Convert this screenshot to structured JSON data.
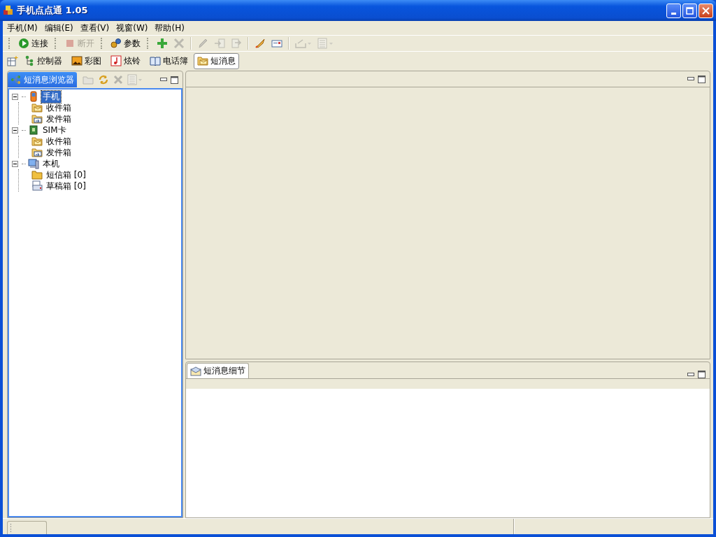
{
  "window": {
    "title": "手机点点通 1.05"
  },
  "menu": [
    {
      "label": "手机(M)"
    },
    {
      "label": "编辑(E)"
    },
    {
      "label": "查看(V)"
    },
    {
      "label": "视窗(W)"
    },
    {
      "label": "帮助(H)"
    }
  ],
  "toolbar": {
    "text_buttons": [
      {
        "label": "连接",
        "disabled": false
      },
      {
        "label": "断开",
        "disabled": true
      },
      {
        "label": "参数",
        "disabled": false
      }
    ],
    "icon_buttons": [
      {
        "disabled": false
      },
      {
        "disabled": true
      },
      {
        "disabled": true
      },
      {
        "disabled": true
      },
      {
        "disabled": true
      },
      {
        "disabled": false
      },
      {
        "disabled": false
      },
      {
        "disabled": true
      },
      {
        "disabled": true
      }
    ]
  },
  "perspectives": [
    {
      "label": "控制器",
      "selected": false
    },
    {
      "label": "彩图",
      "selected": false
    },
    {
      "label": "炫铃",
      "selected": false
    },
    {
      "label": "电话簿",
      "selected": false
    },
    {
      "label": "短消息",
      "selected": true
    }
  ],
  "browser_panel": {
    "tab": {
      "label": "短消息浏览器",
      "selected": true
    },
    "tree": [
      {
        "label": "手机",
        "selected": true,
        "expanded": true,
        "children": [
          {
            "label": "收件箱",
            "selected": false
          },
          {
            "label": "发件箱",
            "selected": false
          }
        ]
      },
      {
        "label": "SIM卡",
        "selected": false,
        "expanded": true,
        "children": [
          {
            "label": "收件箱",
            "selected": false
          },
          {
            "label": "发件箱",
            "selected": false
          }
        ]
      },
      {
        "label": "本机",
        "selected": false,
        "expanded": true,
        "children": [
          {
            "label": "短信箱 [0]",
            "selected": false
          },
          {
            "label": "草稿箱 [0]",
            "selected": false
          }
        ]
      }
    ]
  },
  "detail_panel": {
    "tab": {
      "label": "短消息细节",
      "selected": false
    }
  }
}
